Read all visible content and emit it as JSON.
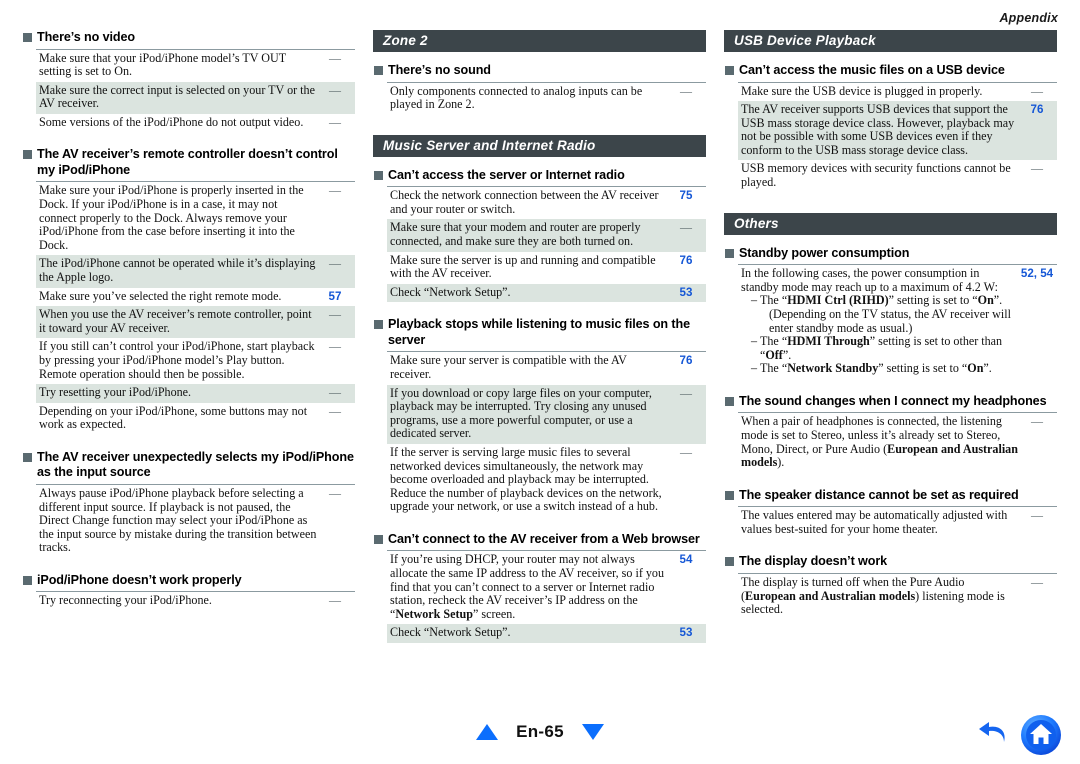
{
  "running_head": "Appendix",
  "footer": {
    "page_label": "En-65",
    "prev_icon": "triangle-up-icon",
    "next_icon": "triangle-down-icon",
    "back_icon": "back-arrow-icon",
    "home_icon": "home-icon"
  },
  "colors": {
    "band_bg": "#3c454a",
    "shade_row": "#dbe4df",
    "page_ref": "#1557d6",
    "nav_blue": "#0b6efd",
    "bullet_square": "#5a6a70"
  },
  "columns": [
    {
      "blocks": [
        {
          "type": "subhead",
          "title": "There’s no video",
          "rows": [
            {
              "text": "Make sure that your iPod/iPhone model’s TV OUT setting is set to On.",
              "ref": "—",
              "shade": false
            },
            {
              "text": "Make sure the correct input is selected on your TV or the AV receiver.",
              "ref": "—",
              "shade": true
            },
            {
              "text": "Some versions of the iPod/iPhone do not output video.",
              "ref": "—",
              "shade": false
            }
          ]
        },
        {
          "type": "subhead",
          "title": "The AV receiver’s remote controller doesn’t control my iPod/iPhone",
          "rows": [
            {
              "text": "Make sure your iPod/iPhone is properly inserted in the Dock. If your iPod/iPhone is in a case, it may not connect properly to the Dock. Always remove your iPod/iPhone from the case before inserting it into the Dock.",
              "ref": "—",
              "shade": false
            },
            {
              "text": "The iPod/iPhone cannot be operated while it’s displaying the Apple logo.",
              "ref": "—",
              "shade": true
            },
            {
              "text": "Make sure you’ve selected the right remote mode.",
              "ref": "57",
              "shade": false
            },
            {
              "text": "When you use the AV receiver’s remote controller, point it toward your AV receiver.",
              "ref": "—",
              "shade": true
            },
            {
              "text": "If you still can’t control your iPod/iPhone, start playback by pressing your iPod/iPhone model’s Play button. Remote operation should then be possible.",
              "ref": "—",
              "shade": false
            },
            {
              "text": "Try resetting your iPod/iPhone.",
              "ref": "—",
              "shade": true
            },
            {
              "text": "Depending on your iPod/iPhone, some buttons may not work as expected.",
              "ref": "—",
              "shade": false
            }
          ]
        },
        {
          "type": "subhead",
          "title": "The AV receiver unexpectedly selects my iPod/iPhone as the input source",
          "rows": [
            {
              "text": "Always pause iPod/iPhone playback before selecting a different input source. If playback is not paused, the Direct Change function may select your iPod/iPhone as the input source by mistake during the transition between tracks.",
              "ref": "—",
              "shade": false
            }
          ]
        },
        {
          "type": "subhead",
          "title": "iPod/iPhone doesn’t work properly",
          "rows": [
            {
              "text": "Try reconnecting your iPod/iPhone.",
              "ref": "—",
              "shade": false
            }
          ]
        }
      ]
    },
    {
      "blocks": [
        {
          "type": "band",
          "title": "Zone 2"
        },
        {
          "type": "subhead",
          "title": "There’s no sound",
          "rows": [
            {
              "text": "Only components connected to analog inputs can be played in Zone 2.",
              "ref": "—",
              "shade": false
            }
          ]
        },
        {
          "type": "band",
          "title": "Music Server and Internet Radio"
        },
        {
          "type": "subhead",
          "title": "Can’t access the server or Internet radio",
          "rows": [
            {
              "text": "Check the network connection between the AV receiver and your router or switch.",
              "ref": "75",
              "shade": false
            },
            {
              "text": "Make sure that your modem and router are properly connected, and make sure they are both turned on.",
              "ref": "—",
              "shade": true
            },
            {
              "text": "Make sure the server is up and running and compatible with the AV receiver.",
              "ref": "76",
              "shade": false
            },
            {
              "text": "Check “Network Setup”.",
              "ref": "53",
              "shade": true
            }
          ]
        },
        {
          "type": "subhead",
          "title": "Playback stops while listening to music files on the server",
          "rows": [
            {
              "text": "Make sure your server is compatible with the AV receiver.",
              "ref": "76",
              "shade": false
            },
            {
              "text": "If you download or copy large files on your computer, playback may be interrupted. Try closing any unused programs, use a more powerful computer, or use a dedicated server.",
              "ref": "—",
              "shade": true
            },
            {
              "text": "If the server is serving large music files to several networked devices simultaneously, the network may become overloaded and playback may be interrupted. Reduce the number of playback devices on the network, upgrade your network, or use a switch instead of a hub.",
              "ref": "—",
              "shade": false
            }
          ]
        },
        {
          "type": "subhead",
          "title": "Can’t connect to the AV receiver from a Web browser",
          "rows": [
            {
              "html": "If you’re using DHCP, your router may not always allocate the same IP address to the AV receiver, so if you find that you can’t connect to a server or Internet radio station, recheck the AV receiver’s IP address on the “<b>Network Setup</b>” screen.",
              "ref": "54",
              "shade": false
            },
            {
              "text": "Check “Network Setup”.",
              "ref": "53",
              "shade": true
            }
          ]
        }
      ]
    },
    {
      "blocks": [
        {
          "type": "band",
          "title": "USB Device Playback"
        },
        {
          "type": "subhead",
          "title": "Can’t access the music files on a USB device",
          "rows": [
            {
              "text": "Make sure the USB device is plugged in properly.",
              "ref": "—",
              "shade": false
            },
            {
              "text": "The AV receiver supports USB devices that support the USB mass storage device class. However, playback may not be possible with some USB devices even if they conform to the USB mass storage device class.",
              "ref": "76",
              "shade": true
            },
            {
              "text": "USB memory devices with security functions cannot be played.",
              "ref": "—",
              "shade": false
            }
          ]
        },
        {
          "type": "band",
          "title": "Others"
        },
        {
          "type": "subhead",
          "title": "Standby power consumption",
          "rows": [
            {
              "html": "In the following cases, the power consumption in standby mode may reach up to a maximum of 4.2 W:<ul class=\"dashlist\"><li>The “<b>HDMI Ctrl (RIHD)</b>” setting is set to “<b>On</b>”.<span class=\"sub\">(Depending on the TV status, the AV receiver will enter standby mode as usual.)</span></li><li>The “<b>HDMI Through</b>” setting is set to other than “<b>Off</b>”.</li><li>The “<b>Network Standby</b>” setting is set to “<b>On</b>”.</li></ul>",
              "ref": "52, 54",
              "shade": false
            }
          ]
        },
        {
          "type": "subhead",
          "title": "The sound changes when I connect my headphones",
          "rows": [
            {
              "html": "When a pair of headphones is connected, the listening mode is set to Stereo, unless it’s already set to Stereo, Mono, Direct, or Pure Audio (<b>European and Australian models</b>).",
              "ref": "—",
              "shade": false
            }
          ]
        },
        {
          "type": "subhead",
          "title": "The speaker distance cannot be set as required",
          "rows": [
            {
              "text": "The values entered may be automatically adjusted with values best-suited for your home theater.",
              "ref": "—",
              "shade": false
            }
          ]
        },
        {
          "type": "subhead",
          "title": "The display doesn’t work",
          "rows": [
            {
              "html": "The display is turned off when the Pure Audio (<b>European and Australian models</b>) listening mode is selected.",
              "ref": "—",
              "shade": false
            }
          ]
        }
      ]
    }
  ]
}
